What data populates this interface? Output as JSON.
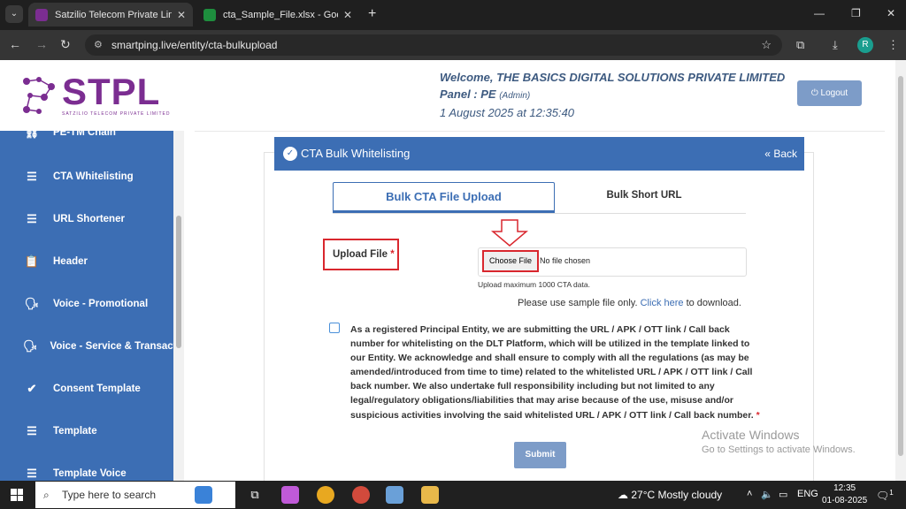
{
  "browser": {
    "tabs": [
      {
        "title": "Satzilio Telecom Private Limited",
        "active": true
      },
      {
        "title": "cta_Sample_File.xlsx - Google Sheets",
        "active": false
      }
    ],
    "url": "smartping.live/entity/cta-bulkupload",
    "profile_initial": "R"
  },
  "logo": {
    "text": "STPL",
    "subtitle": "SATZILIO TELECOM PRIVATE LIMITED"
  },
  "sidebar": {
    "items": [
      {
        "label": "PE-TM Chain",
        "icon": "chain-icon"
      },
      {
        "label": "CTA Whitelisting",
        "icon": "list-icon"
      },
      {
        "label": "URL Shortener",
        "icon": "list-icon"
      },
      {
        "label": "Header",
        "icon": "clipboard-icon"
      },
      {
        "label": "Voice - Promotional",
        "icon": "voice-icon"
      },
      {
        "label": "Voice - Service & Transactional",
        "icon": "voice-icon"
      },
      {
        "label": "Consent Template",
        "icon": "check-circle-icon"
      },
      {
        "label": "Template",
        "icon": "list-icon"
      },
      {
        "label": "Template Voice",
        "icon": "list-icon"
      }
    ]
  },
  "header": {
    "welcome_prefix": "Welcome,",
    "company": "THE BASICS DIGITAL SOLUTIONS PRIVATE LIMITED",
    "panel_prefix": "Panel :",
    "panel": "PE",
    "panel_role": "(Admin)",
    "datetime": "1 August 2025 at 12:35:40",
    "logout_label": "Logout"
  },
  "card": {
    "title": "CTA Bulk Whitelisting",
    "back_label": "Back",
    "tabs": [
      "Bulk CTA File Upload",
      "Bulk Short URL"
    ],
    "upload_label": "Upload File",
    "required_mark": "*",
    "choose_file_label": "Choose File",
    "no_file_text": "No file chosen",
    "hint": "Upload maximum 1000 CTA data.",
    "sample_prefix": "Please use sample file only.",
    "sample_link": "Click here",
    "sample_suffix": "to download.",
    "consent_text": "As a registered Principal Entity, we are submitting the URL / APK / OTT link / Call back number for whitelisting on the DLT Platform, which will be utilized in the template linked to our Entity. We acknowledge and shall ensure to comply with all the regulations (as may be amended/introduced from time to time) related to the whitelisted URL / APK / OTT link / Call back number. We also undertake full responsibility including but not limited to any legal/regulatory obligations/liabilities that may arise because of the use, misuse and/or suspicious activities involving the said whitelisted URL / APK / OTT link / Call back number.",
    "consent_checked": false,
    "submit_label": "Submit"
  },
  "watermark": {
    "line1": "Activate Windows",
    "line2": "Go to Settings to activate Windows."
  },
  "taskbar": {
    "search_placeholder": "Type here to search",
    "weather": "27°C  Mostly cloudy",
    "language": "ENG",
    "time": "12:35",
    "date": "01-08-2025",
    "notification_count": "1"
  },
  "colors": {
    "primary": "#3c6eb4",
    "brand": "#7b2d91",
    "highlight_red": "#d9272e"
  }
}
